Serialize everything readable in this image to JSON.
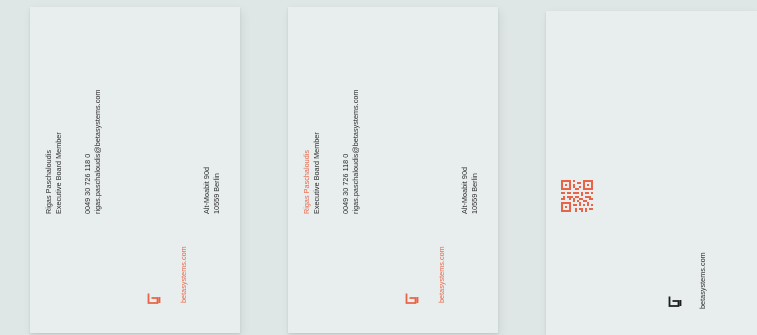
{
  "cards": [
    {
      "name": "Rigas Paschaloudis",
      "title": "Executive Board Member",
      "phone": "0049 30 726 118 0",
      "email": "rigas.paschaloudis@betasystems.com",
      "address_line1": "Alt-Moabit 90d",
      "address_line2": "10559 Berlin",
      "website": "betasystems.com"
    },
    {
      "name": "Rigas Paschaloudis",
      "title": "Executive Board Member",
      "phone": "0049 30 726 118 0",
      "email": "rigas.paschaloudis@betasystems.com",
      "address_line1": "Alt-Moabit 90d",
      "address_line2": "10559 Berlin",
      "website": "betasystems.com"
    },
    {
      "website": "betasystems.com"
    }
  ],
  "colors": {
    "accent": "#e96446",
    "ink": "#2b2b2b",
    "card": "#e8eded",
    "background": "#dfe6e6"
  },
  "icons": {
    "logo": "beta-logo-icon",
    "qr": "qr-code-icon"
  }
}
